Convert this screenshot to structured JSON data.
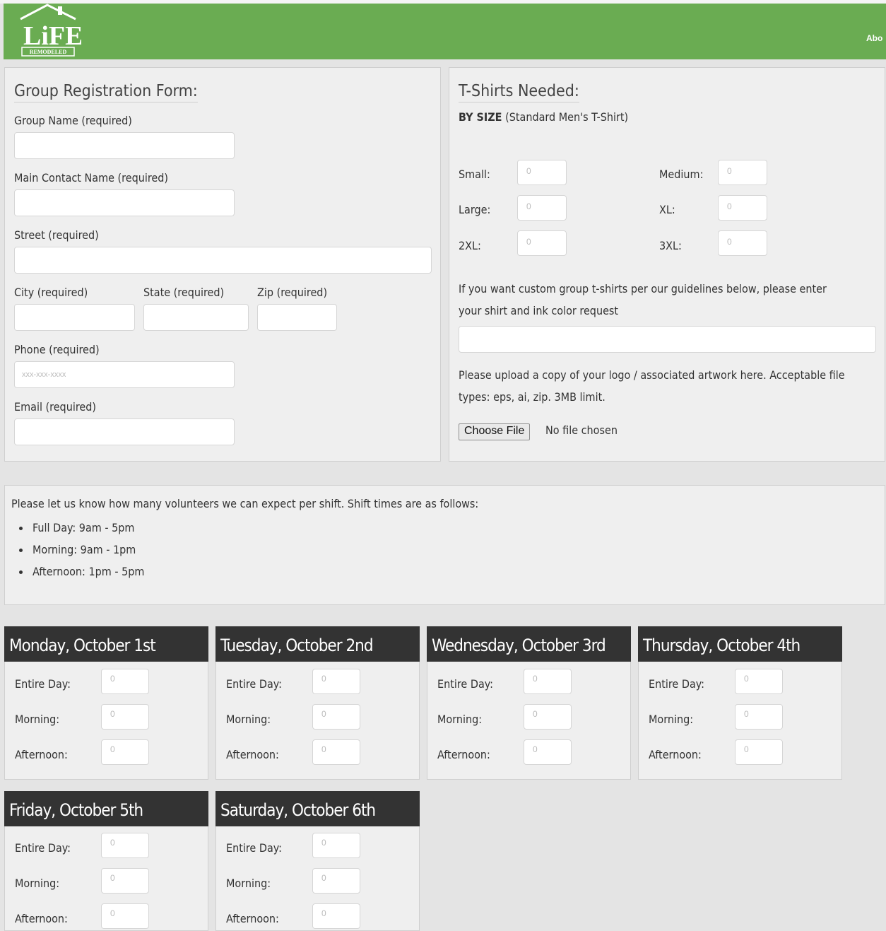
{
  "header": {
    "logo_text": "LiFE",
    "logo_subtext": "REMODELED",
    "nav_about": "Abo",
    "brand_color": "#6aac52"
  },
  "registration": {
    "title": "Group Registration Form:",
    "group_name_label": "Group Name (required)",
    "contact_label": "Main Contact Name (required)",
    "street_label": "Street (required)",
    "city_label": "City (required)",
    "state_label": "State (required)",
    "zip_label": "Zip (required)",
    "phone_label": "Phone (required)",
    "phone_placeholder": "xxx-xxx-xxxx",
    "email_label": "Email (required)"
  },
  "tshirts": {
    "title": "T-Shirts Needed:",
    "by_size_bold": "BY SIZE",
    "by_size_note": "(Standard Men's T-Shirt)",
    "sizes": [
      {
        "label": "Small:",
        "value": "0"
      },
      {
        "label": "Medium:",
        "value": "0"
      },
      {
        "label": "Large:",
        "value": "0"
      },
      {
        "label": "XL:",
        "value": "0"
      },
      {
        "label": "2XL:",
        "value": "0"
      },
      {
        "label": "3XL:",
        "value": "0"
      }
    ],
    "custom_line1": "If you want custom group t-shirts per our guidelines below, please enter",
    "custom_line2": "your shirt and ink color request",
    "upload_line1": "Please upload a copy of your logo / associated artwork here. Acceptable file",
    "upload_line2": "types: eps, ai, zip. 3MB limit.",
    "choose_file": "Choose File",
    "no_file": "No file chosen"
  },
  "shifts": {
    "intro": "Please let us know how many volunteers we can expect per shift. Shift times are as follows:",
    "items": [
      "Full Day: 9am - 5pm",
      "Morning: 9am - 1pm",
      "Afternoon: 1pm - 5pm"
    ]
  },
  "days": [
    {
      "title": "Monday, October 1st"
    },
    {
      "title": "Tuesday, October 2nd"
    },
    {
      "title": "Wednesday, October 3rd"
    },
    {
      "title": "Thursday, October 4th"
    },
    {
      "title": "Friday, October 5th"
    },
    {
      "title": "Saturday, October 6th"
    }
  ],
  "day_fields": {
    "entire": "Entire Day:",
    "morning": "Morning:",
    "afternoon": "Afternoon:",
    "default_value": "0"
  }
}
